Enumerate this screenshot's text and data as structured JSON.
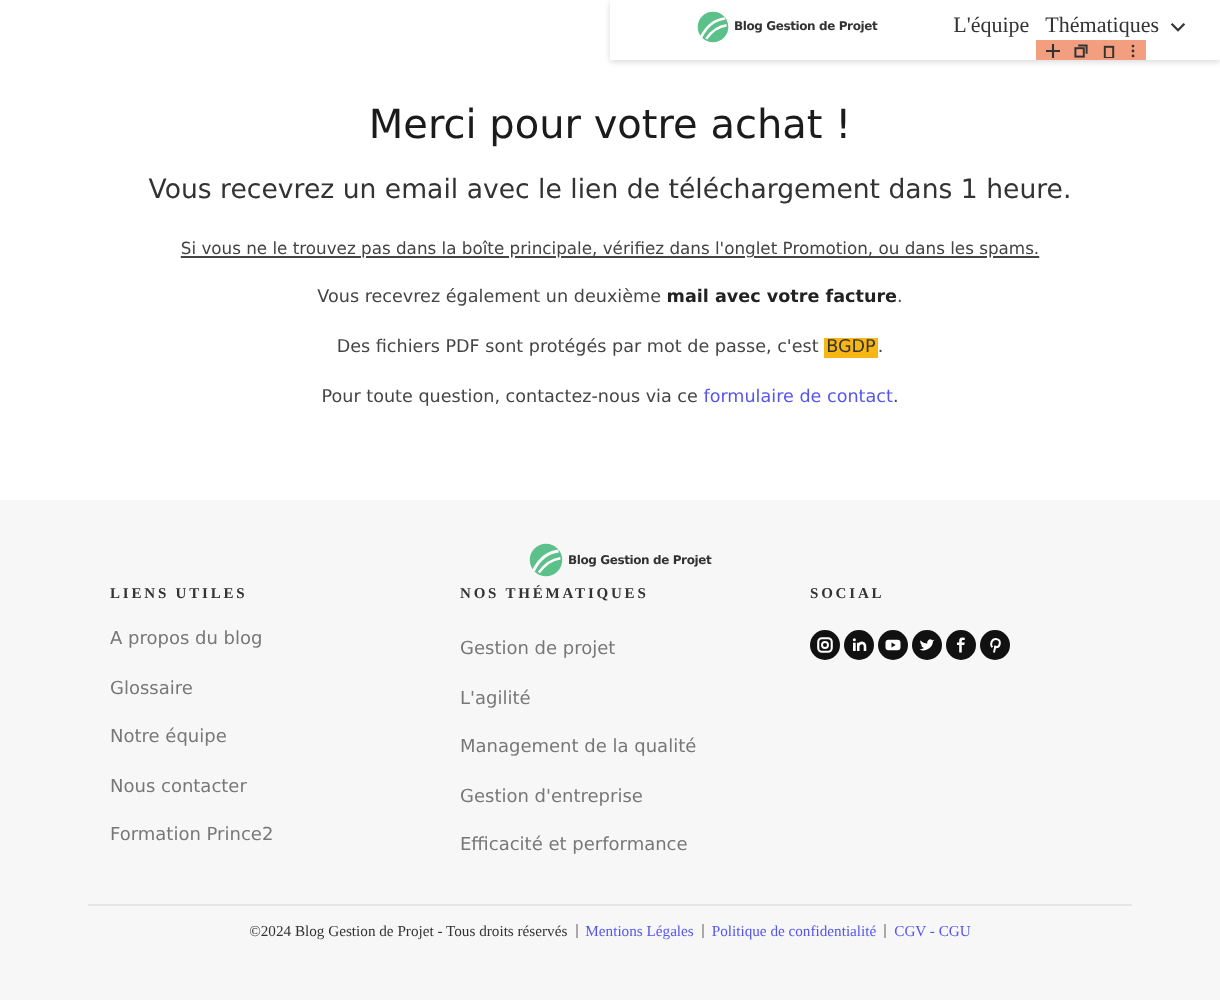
{
  "header": {
    "logo_text": "Blog Gestion de Projet",
    "nav": [
      {
        "label": "L'équipe",
        "dropdown": false
      },
      {
        "label": "Thématiques",
        "dropdown": true
      }
    ]
  },
  "main": {
    "title": "Merci pour votre achat !",
    "subtitle": "Vous recevrez un email avec le lien de téléchargement dans 1 heure.",
    "note": "Si vous ne le trouvez pas dans la boîte principale, vérifiez dans l'onglet Promotion, ou dans les spams.",
    "invoice": "Vous recevrez également un deuxième **mail avec votre facture**.",
    "password": {
      "before": "Des fichiers PDF sont protégés par mot de passe, c'est ",
      "highlight": "BGDP",
      "after": "."
    },
    "contact": {
      "text": "Pour toute question, contactez-nous via ce ",
      "link": "formulaire de contact",
      "after": "."
    }
  },
  "footer": {
    "logo_text": "Blog Gestion de Projet",
    "columns": [
      {
        "heading": "LIENS UTILES",
        "links": [
          "A propos du blog",
          "Glossaire",
          "Notre équipe",
          "Nous contacter",
          "Formation Prince2"
        ]
      },
      {
        "heading": "NOS THÉMATIQUES",
        "links": [
          "Gestion de projet",
          "L'agilité",
          "Management de la qualité",
          "Gestion d'entreprise",
          "Efficacité et performance"
        ]
      },
      {
        "heading": "SOCIAL"
      }
    ],
    "copyright": "©2024 Blog Gestion de Projet  - Tous droits réservés",
    "legal_links": [
      "Mentions Légales",
      "Politique de confidentialité",
      "CGV - CGU"
    ]
  }
}
